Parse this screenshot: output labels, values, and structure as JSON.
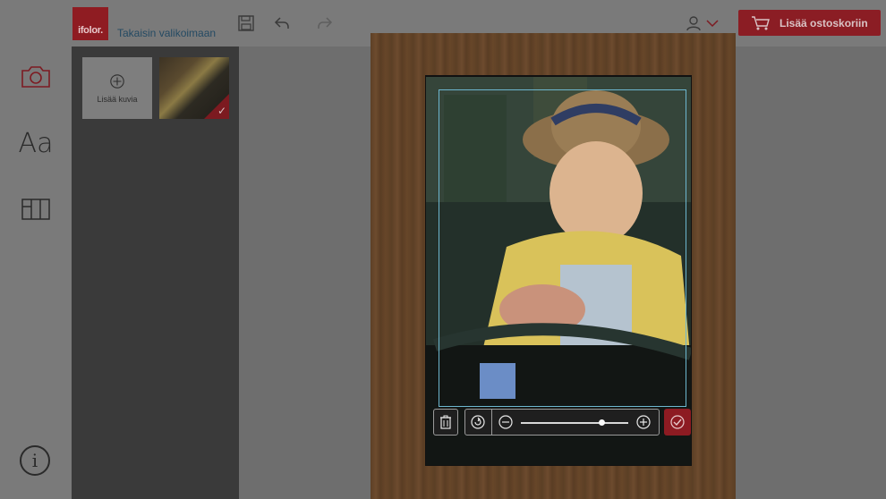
{
  "header": {
    "logo_text": "ifolor.",
    "back_link": "Takaisin valikoimaan",
    "cart_button": "Lisää ostoskoriin",
    "icons": [
      "save-icon",
      "undo-icon",
      "redo-icon",
      "user-icon",
      "chevron-down-icon",
      "cart-icon"
    ]
  },
  "rail": {
    "items": [
      {
        "name": "camera-icon"
      },
      {
        "label": "Aa",
        "name": "text-icon"
      },
      {
        "name": "layout-icon"
      }
    ],
    "info_label": "i"
  },
  "photo_panel": {
    "add_photos_label": "Lisää kuvia",
    "thumbnails": [
      {
        "selected": true
      }
    ]
  },
  "editor_toolbar": {
    "zoom_level": 0.75,
    "icons": [
      "trash-icon",
      "rotate-icon",
      "zoom-out-icon",
      "zoom-in-icon",
      "confirm-check-icon"
    ]
  },
  "colors": {
    "brand": "#8b1d24",
    "crop_frame": "#6db7cf"
  }
}
